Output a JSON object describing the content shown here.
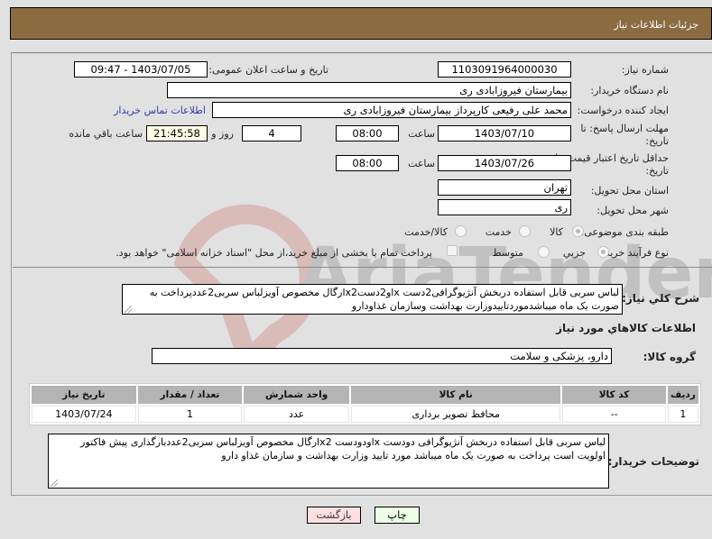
{
  "header": {
    "title": "جزئیات اطلاعات نیاز"
  },
  "form": {
    "need_number": {
      "label": "شماره نیاز:",
      "value": "1103091964000030"
    },
    "announce_datetime": {
      "label": "تاریخ و ساعت اعلان عمومی:",
      "value": "1403/07/05 - 09:47"
    },
    "buyer_org": {
      "label": "نام دستگاه خریدار:",
      "value": "بیمارستان فیروزابادی ری"
    },
    "requester": {
      "label": "ایجاد کننده درخواست:",
      "value": "محمد علی رفیعی کارپرداز بیمارستان فیروزابادی ری"
    },
    "buyer_contact_link": "اطلاعات تماس خریدار",
    "response_deadline": {
      "label_line1": "مهلت ارسال پاسخ: تا",
      "label_line2": "تاریخ:",
      "date": "1403/07/10",
      "time_label": "ساعت",
      "time": "08:00",
      "days": "4",
      "days_label": "روز و",
      "remaining": "21:45:58",
      "remaining_label": "ساعت باقي مانده"
    },
    "price_validity": {
      "label_line1": "حداقل تاریخ اعتبار قیمت: تا",
      "label_line2": "تاریخ:",
      "date": "1403/07/26",
      "time_label": "ساعت",
      "time": "08:00"
    },
    "delivery_province": {
      "label": "استان محل تحویل:",
      "value": "تهران"
    },
    "delivery_city": {
      "label": "شهر محل تحویل:",
      "value": "ری"
    },
    "category": {
      "label": "طبقه بندی موضوعی:",
      "options": [
        "کالا",
        "خدمت",
        "کالا/خدمت"
      ],
      "selected": "کالا"
    },
    "purchase_type": {
      "label": "نوع فرآیند خرید :",
      "options": [
        "جزیي",
        "متوسط"
      ],
      "selected": "جزیي",
      "treasury_note": "پرداخت تمام یا بخشی از مبلغ خرید،از محل \"اسناد خزانه اسلامی\" خواهد بود.",
      "treasury_checked": false
    },
    "general_description": {
      "label": "شرح کلي نياز:",
      "value": "لباس سربی قابل استفاده دربخش آنژیوگرافی2دست lxو2دستlx2رگال مخصوص آویزلباس سربی2عددپرداخت به صورت یک ماه میباشدموردتاییدوزارت بهداشت وسازمان غذاودارو"
    },
    "goods_info_title": "اطلاعات کالاهاي مورد نياز",
    "goods_group": {
      "label": "گروه کالا:",
      "value": "دارو، پزشکی و سلامت"
    }
  },
  "table": {
    "columns": [
      "رديف",
      "کد کالا",
      "نام کالا",
      "واحد شمارش",
      "تعداد / مقدار",
      "تاريخ نياز"
    ],
    "rows": [
      {
        "row": "1",
        "code": "--",
        "name": "محافظ تصویر برداری",
        "unit": "عدد",
        "qty": "1",
        "date": "1403/07/24"
      }
    ]
  },
  "buyer_notes": {
    "label": "توضیحات خریدار:",
    "value": "لباس سربی قابل استفاده دربخش آنژیوگرافی دودست lxودودست lx2رگال مخصوص آویزلباس سربی2عددبارگذاری پیش فاکتور اولویت است پرداخت به صورت یک ماه میباشد مورد تایید وزارت بهداشت و سازمان غذاو دارو"
  },
  "buttons": {
    "print": "چاپ",
    "back": "بازگشت"
  },
  "colors": {
    "header_bg": "#8b6c41",
    "back_btn_bg": "#ffe0e0",
    "print_btn_bg": "#ecffe6",
    "link": "#2b3bb5"
  },
  "watermark_text": "AriaTender.net"
}
